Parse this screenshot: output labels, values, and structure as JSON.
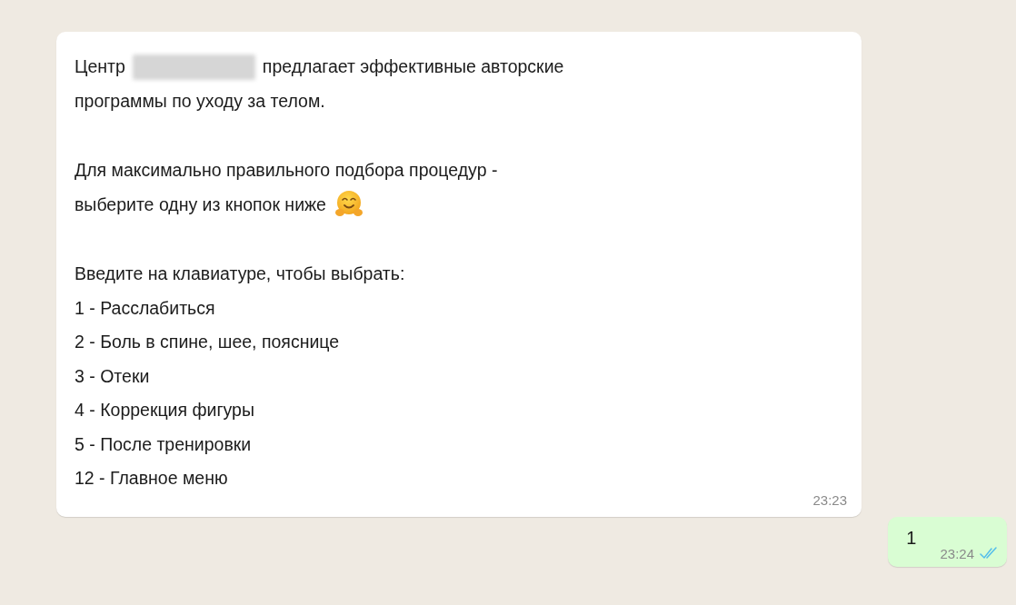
{
  "messages": [
    {
      "kind": "incoming",
      "paragraphs": [
        [
          [
            {
              "kind": "text",
              "text": "Центр"
            },
            {
              "kind": "redacted"
            },
            {
              "kind": "text",
              "text": "предлагает эффективные авторские"
            }
          ],
          [
            {
              "kind": "text",
              "text": "программы по уходу за телом."
            }
          ]
        ],
        [
          [
            {
              "kind": "text",
              "text": "Для максимально правильного подбора процедур -"
            }
          ],
          [
            {
              "kind": "text",
              "text": "выберите одну из кнопок ниже"
            },
            {
              "kind": "emoji"
            }
          ]
        ],
        [
          [
            {
              "kind": "text",
              "text": "Введите на клавиатуре, чтобы выбрать:"
            }
          ],
          [
            {
              "kind": "text",
              "text": "1 - Расслабиться"
            }
          ],
          [
            {
              "kind": "text",
              "text": "2 - Боль в спине, шее, пояснице"
            }
          ],
          [
            {
              "kind": "text",
              "text": "3 - Отеки"
            }
          ],
          [
            {
              "kind": "text",
              "text": "4 - Коррекция фигуры"
            }
          ],
          [
            {
              "kind": "text",
              "text": "5 - После тренировки"
            }
          ],
          [
            {
              "kind": "text",
              "text": "12 - Главное меню"
            }
          ]
        ]
      ],
      "time": "23:23"
    },
    {
      "kind": "outgoing",
      "paragraphs": [
        [
          [
            {
              "kind": "text",
              "text": "1"
            }
          ]
        ]
      ],
      "time": "23:24",
      "read": true
    }
  ]
}
